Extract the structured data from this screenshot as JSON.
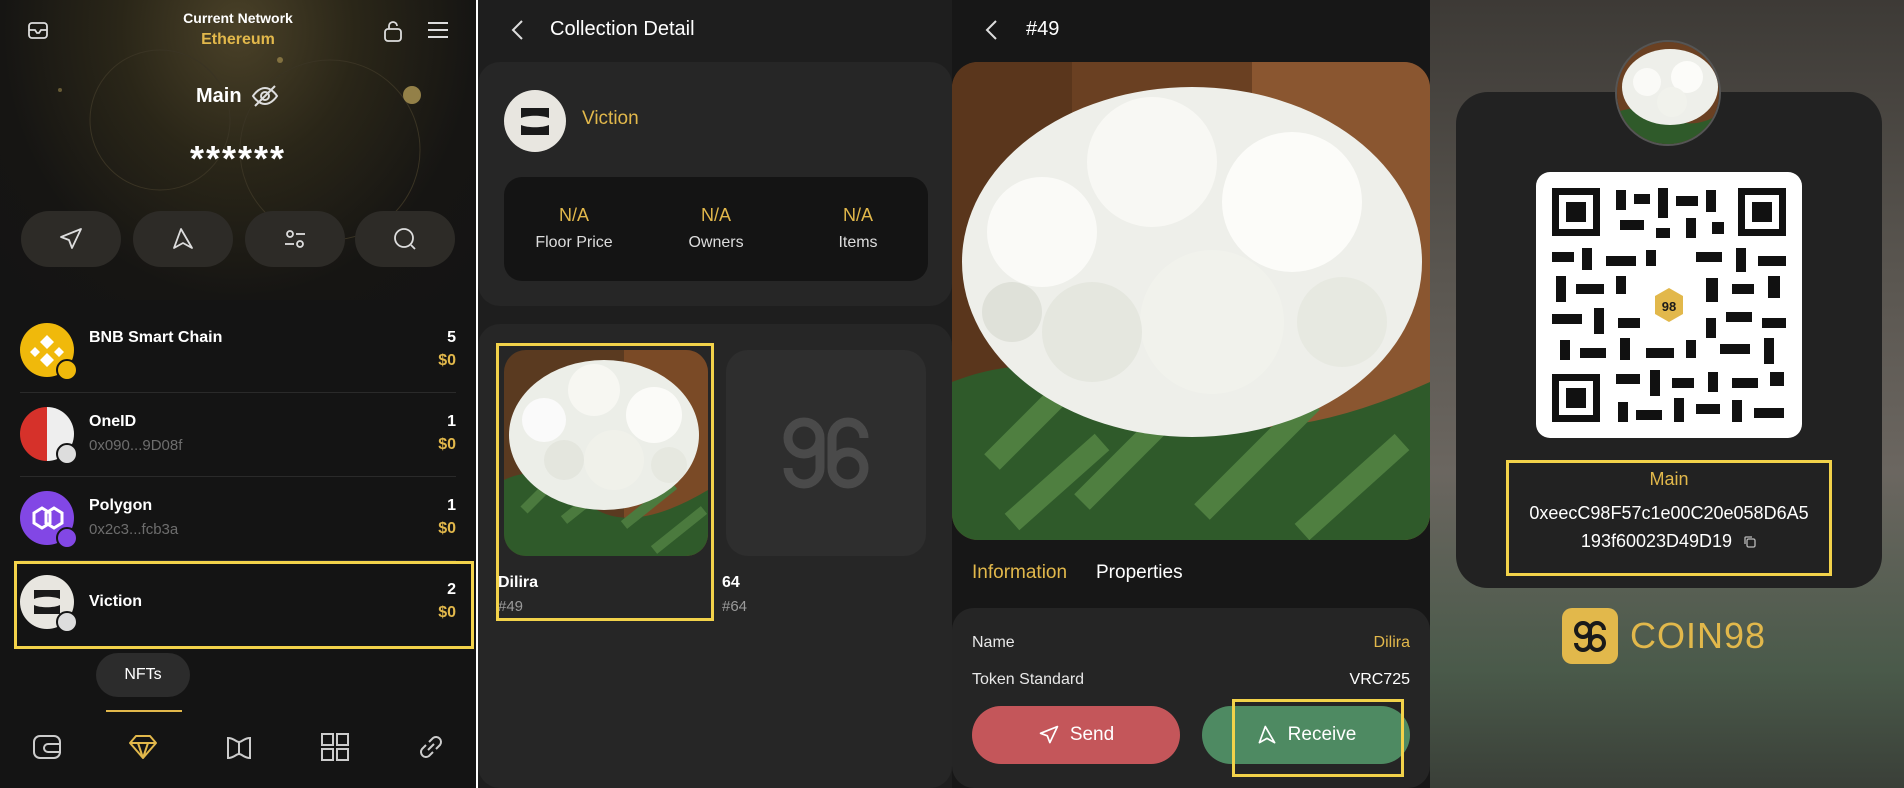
{
  "panel1": {
    "network_title": "Current Network",
    "network_name": "Ethereum",
    "wallet_name": "Main",
    "balance": "******",
    "chains": [
      {
        "name": "BNB Smart Chain",
        "address": "",
        "count": "5",
        "value": "$0"
      },
      {
        "name": "OneID",
        "address": "0x090...9D08f",
        "count": "1",
        "value": "$0"
      },
      {
        "name": "Polygon",
        "address": "0x2c3...fcb3a",
        "count": "1",
        "value": "$0"
      },
      {
        "name": "Viction",
        "address": "",
        "count": "2",
        "value": "$0"
      }
    ],
    "tooltip": "NFTs"
  },
  "panel2": {
    "title": "Collection Detail",
    "collection_name": "Viction",
    "stats": [
      {
        "value": "N/A",
        "label": "Floor Price"
      },
      {
        "value": "N/A",
        "label": "Owners"
      },
      {
        "value": "N/A",
        "label": "Items"
      }
    ],
    "nfts": [
      {
        "name": "Dilira",
        "id": "#49"
      },
      {
        "name": "64",
        "id": "#64"
      }
    ]
  },
  "panel3": {
    "title": "#49",
    "tabs": [
      "Information",
      "Properties"
    ],
    "info": [
      {
        "key": "Name",
        "value": "Dilira"
      },
      {
        "key": "Token Standard",
        "value": "VRC725"
      }
    ],
    "send_label": "Send",
    "receive_label": "Receive"
  },
  "panel4": {
    "wallet_name": "Main",
    "address_line1": "0xeecC98F57c1e00C20e058D6A5",
    "address_line2": "193f60023D49D19",
    "brand": "COIN98"
  },
  "colors": {
    "accent": "#e2b84b",
    "highlight": "#f2d24a",
    "send": "#c4565a",
    "receive": "#4e8a62"
  }
}
